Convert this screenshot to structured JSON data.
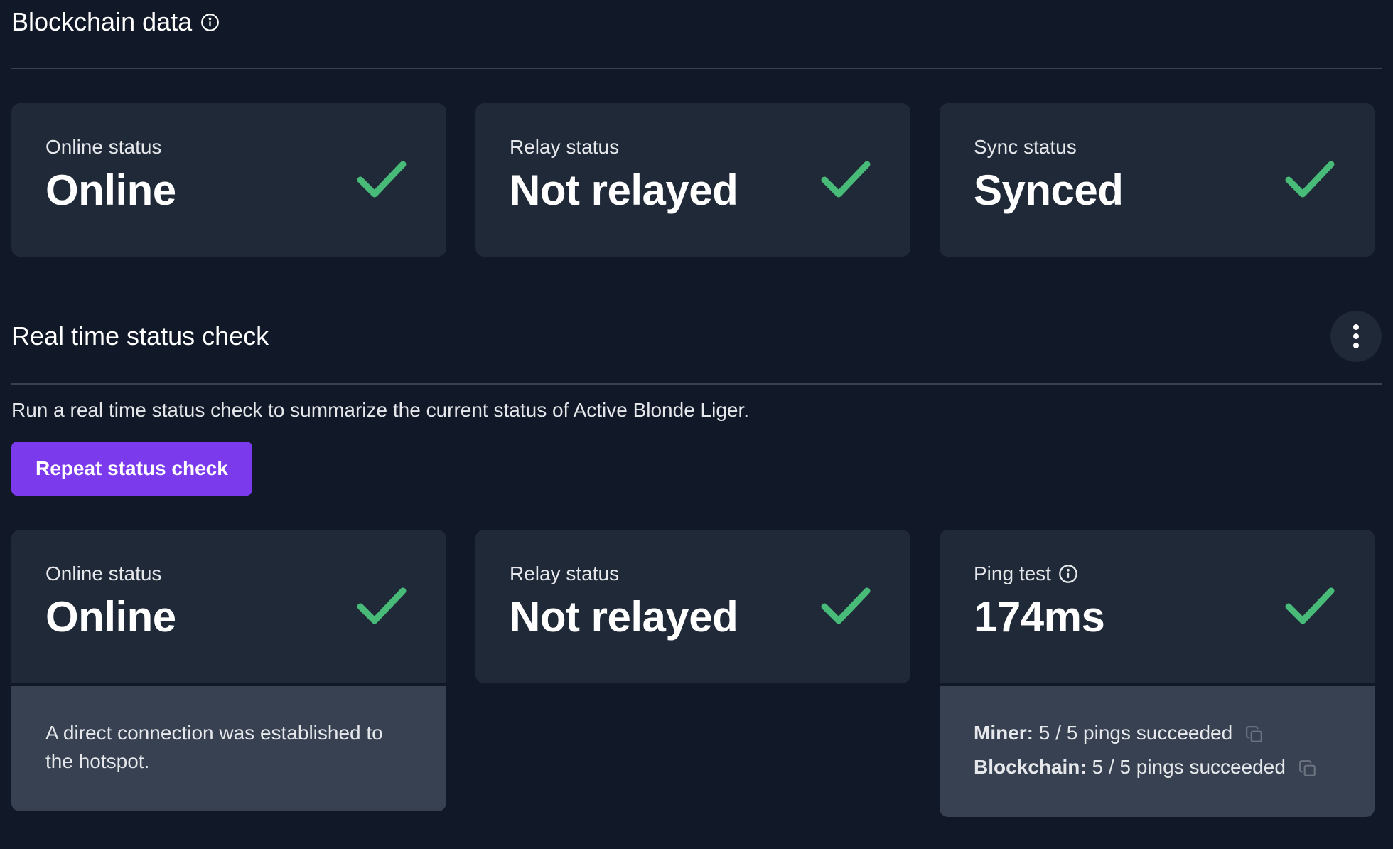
{
  "blockchain": {
    "title": "Blockchain data",
    "cards": [
      {
        "label": "Online status",
        "value": "Online"
      },
      {
        "label": "Relay status",
        "value": "Not relayed"
      },
      {
        "label": "Sync status",
        "value": "Synced"
      }
    ]
  },
  "realtime": {
    "title": "Real time status check",
    "description": "Run a real time status check to summarize the current status of Active Blonde Liger.",
    "button_label": "Repeat status check",
    "cards": [
      {
        "label": "Online status",
        "value": "Online",
        "detail": "A direct connection was established to the hotspot."
      },
      {
        "label": "Relay status",
        "value": "Not relayed"
      },
      {
        "label": "Ping test",
        "value": "174ms",
        "miner_key": "Miner:",
        "miner_value": "5 / 5 pings succeeded",
        "blockchain_key": "Blockchain:",
        "blockchain_value": "5 / 5 pings succeeded"
      }
    ]
  },
  "colors": {
    "accent": "#7c3aed",
    "success": "#48bb78",
    "background": "#111827",
    "card": "#1f2937",
    "card_foot": "#374151"
  },
  "icons": {
    "info": "info-circle-icon",
    "check": "checkmark-icon",
    "menu": "vertical-dots-icon",
    "copy": "copy-icon"
  }
}
